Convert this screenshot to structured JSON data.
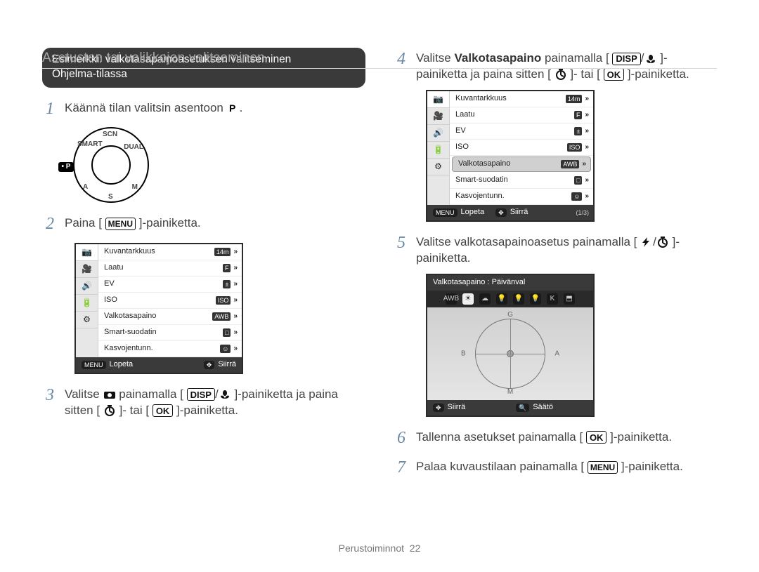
{
  "page_title": "Asetusten tai valikkojen valitseminen",
  "footer": {
    "section": "Perustoiminnot",
    "page_num": "22"
  },
  "example_pill": {
    "line1": "Esimerkki: valkotasapainoasetuksen valitseminen",
    "line2": "Ohjelma-tilassa"
  },
  "labels": {
    "MENU": "MENU",
    "DISP": "DISP",
    "OK": "OK"
  },
  "step1": {
    "pre": "Käännä tilan valitsin asentoon ",
    "post": "."
  },
  "step2": {
    "pre": "Paina [",
    "post": "]-painiketta."
  },
  "step3": {
    "a": "Valitse ",
    "b": " painamalla [",
    "c": "/",
    "d": "]-painiketta ja paina sitten [",
    "e": "]- tai [",
    "f": "]-painiketta."
  },
  "step4": {
    "a": "Valitse ",
    "bold": "Valkotasapaino",
    "b": " painamalla [",
    "c": "/",
    "d": "]-painiketta ja paina sitten [",
    "e": "]- tai [",
    "f": "]-painiketta."
  },
  "step5": {
    "a": "Valitse valkotasapainoasetus painamalla [",
    "b": "/",
    "c": "]-painiketta."
  },
  "step6": {
    "a": "Tallenna asetukset painamalla [",
    "b": "]-painiketta."
  },
  "step7": {
    "a": "Palaa kuvaustilaan painamalla [",
    "b": "]-painiketta."
  },
  "dial": {
    "pointer": "• P",
    "marks": {
      "top": "SCN",
      "r": "DUAL",
      "br": "M",
      "b": "S",
      "bl": "A",
      "tl": "SMART"
    }
  },
  "lcd1": {
    "tabs_icons": [
      "camera",
      "video",
      "sound",
      "battery",
      "gear"
    ],
    "rows": [
      {
        "label": "Kuvantarkkuus",
        "value": "14m",
        "chev": "»"
      },
      {
        "label": "Laatu",
        "value": "F",
        "chev": "»"
      },
      {
        "label": "EV",
        "value": "±",
        "chev": "»"
      },
      {
        "label": "ISO",
        "value": "ISO",
        "chev": "»"
      },
      {
        "label": "Valkotasapaino",
        "value": "AWB",
        "chev": "»"
      },
      {
        "label": "Smart-suodatin",
        "value": "□",
        "chev": "»"
      },
      {
        "label": "Kasvojentunn.",
        "value": "☺",
        "chev": "»"
      }
    ],
    "footer": {
      "left_btn": "MENU",
      "left_label": "Lopeta",
      "right_label": "Siirrä"
    }
  },
  "lcd2": {
    "tabs_icons": [
      "camera",
      "video",
      "sound",
      "battery",
      "gear"
    ],
    "selected_index": 4,
    "rows": [
      {
        "label": "Kuvantarkkuus",
        "value": "14m",
        "chev": "»"
      },
      {
        "label": "Laatu",
        "value": "F",
        "chev": "»"
      },
      {
        "label": "EV",
        "value": "±",
        "chev": "»"
      },
      {
        "label": "ISO",
        "value": "ISO",
        "chev": "»"
      },
      {
        "label": "Valkotasapaino",
        "value": "AWB",
        "chev": "»"
      },
      {
        "label": "Smart-suodatin",
        "value": "□",
        "chev": "»"
      },
      {
        "label": "Kasvojentunn.",
        "value": "☺",
        "chev": "»"
      }
    ],
    "footer": {
      "left_btn": "MENU",
      "left_label": "Lopeta",
      "right_label": "Siirrä",
      "pager": "(1/3)"
    }
  },
  "wb_panel": {
    "title": "Valkotasapaino : Päivänval",
    "icons": [
      "AWB",
      "☀",
      "☁",
      "💡",
      "💡",
      "💡",
      "K",
      "⬒"
    ],
    "axis": {
      "top": "G",
      "right": "A",
      "bottom": "M",
      "left": "B"
    },
    "footer": {
      "left_label": "Siirrä",
      "right_label": "Säätö"
    }
  }
}
